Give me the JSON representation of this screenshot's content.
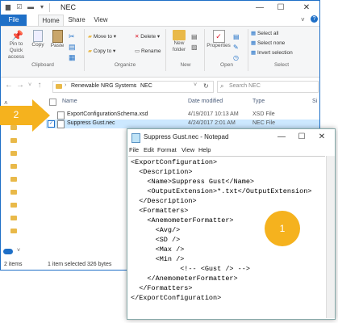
{
  "explorer": {
    "title": "NEC",
    "controls": {
      "minimize": "—",
      "maximize": "☐",
      "close": "✕"
    },
    "tabs": [
      "File",
      "Home",
      "Share",
      "View"
    ],
    "ribbon": {
      "clipboard": {
        "label": "Clipboard",
        "pin": "Pin to Quick access",
        "copy": "Copy",
        "paste": "Paste"
      },
      "organize": {
        "label": "Organize",
        "move_to": "Move to",
        "copy_to": "Copy to",
        "delete": "Delete",
        "rename": "Rename"
      },
      "new": {
        "label": "New",
        "new_folder": "New folder"
      },
      "open": {
        "label": "Open",
        "properties": "Properties"
      },
      "select": {
        "label": "Select",
        "select_all": "Select all",
        "select_none": "Select none",
        "invert": "Invert selection"
      }
    },
    "breadcrumb": [
      "Renewable NRG Systems",
      "NEC"
    ],
    "search_placeholder": "Search NEC",
    "columns": {
      "name": "Name",
      "date": "Date modified",
      "type": "Type",
      "size": "Si"
    },
    "files": [
      {
        "name": "ExportConfigurationSchema.xsd",
        "date": "4/19/2017 10:13 AM",
        "type": "XSD File"
      },
      {
        "name": "Suppress Gust.nec",
        "date": "4/24/2017 2:01 AM",
        "type": "NEC File"
      }
    ],
    "status": {
      "items": "2 items",
      "selected": "1 item selected  326 bytes"
    }
  },
  "notepad": {
    "title": "Suppress Gust.nec - Notepad",
    "menu": [
      "File",
      "Edit",
      "Format",
      "View",
      "Help"
    ],
    "controls": {
      "minimize": "—",
      "maximize": "☐",
      "close": "✕"
    },
    "lines": [
      "<ExportConfiguration>",
      "  <Description>",
      "    <Name>Suppress Gust</Name>",
      "    <OutputExtension>*.txt</OutputExtension>",
      "  </Description>",
      "  <Formatters>",
      "    <AnemometerFormatter>",
      "      <Avg/>",
      "      <SD />",
      "      <Max />",
      "      <Min />",
      "            <!-- <Gust /> -->",
      "    </AnemometerFormatter>",
      "  </Formatters>",
      "</ExportConfiguration>"
    ]
  },
  "callouts": {
    "one": "1",
    "two": "2"
  },
  "colors": {
    "accent": "#1e6fc7",
    "callout": "#f5b21e",
    "selection": "#cce8ff"
  }
}
